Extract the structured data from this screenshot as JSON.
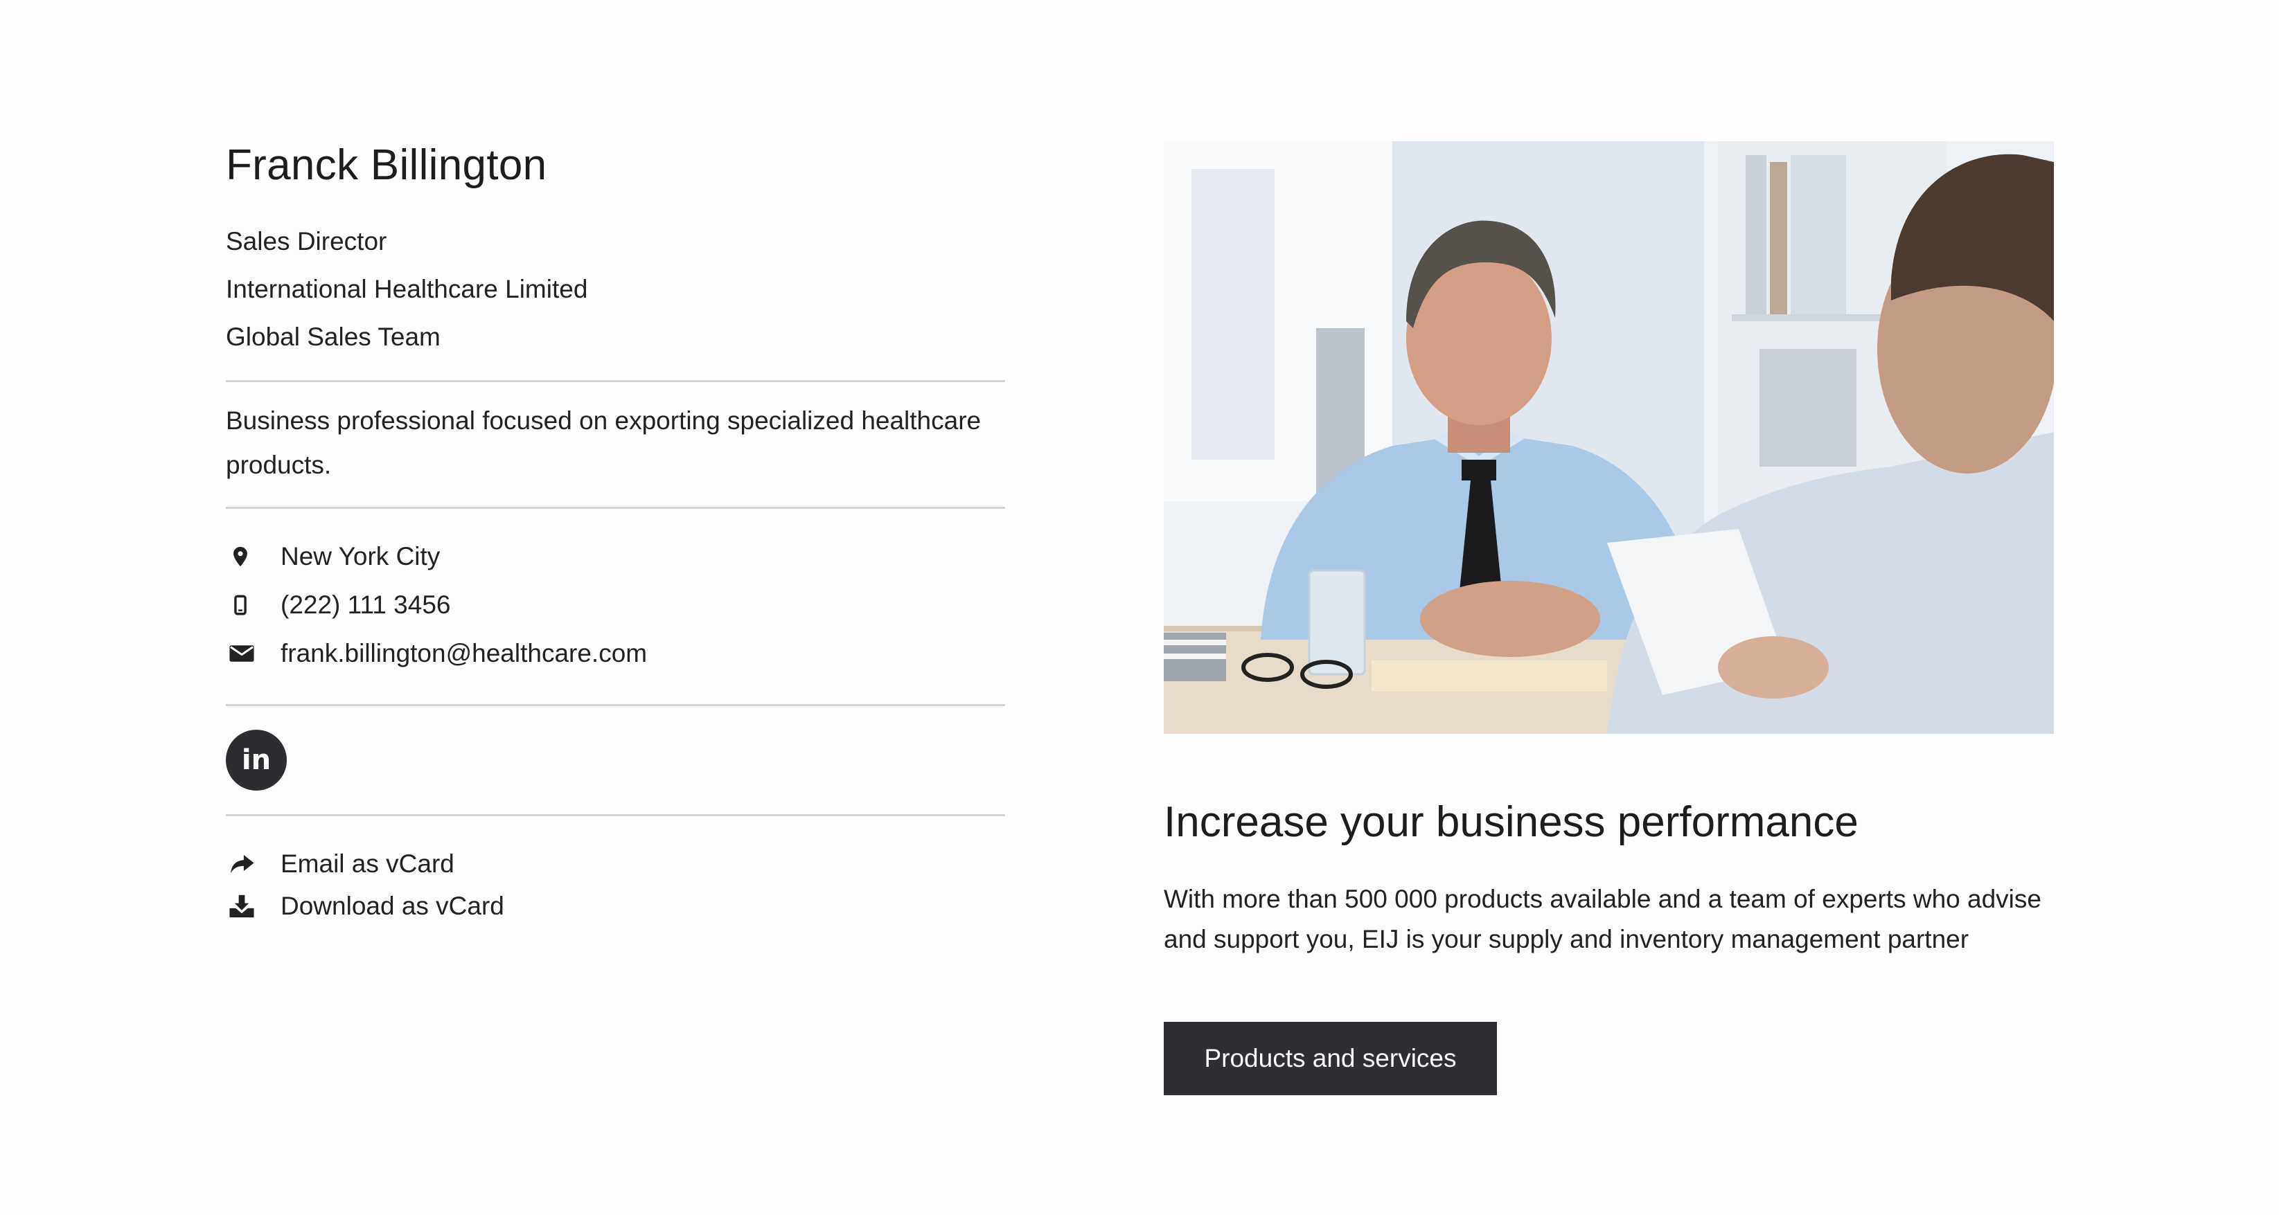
{
  "profile": {
    "name": "Franck Billington",
    "title": "Sales Director",
    "company": "International Healthcare Limited",
    "team": "Global Sales Team",
    "bio": "Business professional focused on exporting specialized healthcare products."
  },
  "contact": {
    "location": {
      "icon": "map-marker-icon",
      "text": "New York City"
    },
    "phone": {
      "icon": "mobile-phone-icon",
      "text": "(222) 111 3456"
    },
    "email": {
      "icon": "envelope-icon",
      "text": "frank.billington@healthcare.com"
    }
  },
  "social": {
    "linkedin": {
      "icon": "linkedin-icon",
      "label": "in"
    }
  },
  "vcard": {
    "email": {
      "icon": "share-icon",
      "label": "Email as vCard"
    },
    "download": {
      "icon": "download-icon",
      "label": "Download as vCard"
    }
  },
  "promo": {
    "image_description_icon": "business-meeting-photo",
    "headline": "Increase your business performance",
    "description": "With more than 500 000 products available and a team of experts who advise and support you, EIJ is your supply and inventory management partner",
    "button_label": "Products and services"
  },
  "colors": {
    "text": "#222222",
    "divider": "#d3d3d3",
    "button_bg": "#2e2e33",
    "button_text": "#ffffff"
  }
}
